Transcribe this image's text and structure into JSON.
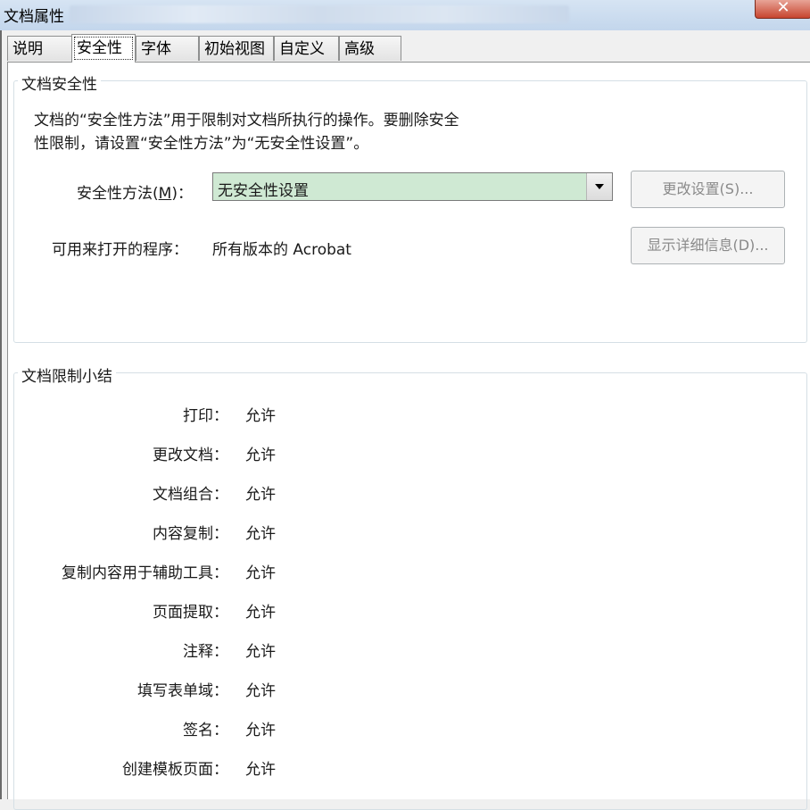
{
  "window": {
    "title": "文档属性",
    "close_symbol": "✕"
  },
  "tabs": [
    {
      "label": "说明"
    },
    {
      "label": "安全性"
    },
    {
      "label": "字体"
    },
    {
      "label": "初始视图"
    },
    {
      "label": "自定义"
    },
    {
      "label": "高级"
    }
  ],
  "security": {
    "group_title": "文档安全性",
    "description_line1": "文档的“安全性方法”用于限制对文档所执行的操作。要删除安全",
    "description_line2": "性限制，请设置“安全性方法”为“无安全性设置”。",
    "method_label_prefix": "安全性方法(",
    "method_label_key": "M",
    "method_label_suffix": ")：",
    "method_value": "无安全性设置",
    "change_settings_button": "更改设置(S)...",
    "openable_label": "可用来打开的程序：",
    "openable_value": "所有版本的 Acrobat",
    "show_details_button": "显示详细信息(D)..."
  },
  "restrictions": {
    "group_title": "文档限制小结",
    "rows": [
      {
        "label": "打印：",
        "value": "允许"
      },
      {
        "label": "更改文档：",
        "value": "允许"
      },
      {
        "label": "文档组合：",
        "value": "允许"
      },
      {
        "label": "内容复制：",
        "value": "允许"
      },
      {
        "label": "复制内容用于辅助工具：",
        "value": "允许"
      },
      {
        "label": "页面提取：",
        "value": "允许"
      },
      {
        "label": "注释：",
        "value": "允许"
      },
      {
        "label": "填写表单域：",
        "value": "允许"
      },
      {
        "label": "签名：",
        "value": "允许"
      },
      {
        "label": "创建模板页面：",
        "value": "允许"
      }
    ]
  },
  "colors": {
    "combo_highlight": "#cfe9d3",
    "close_button": "#c7452f"
  }
}
